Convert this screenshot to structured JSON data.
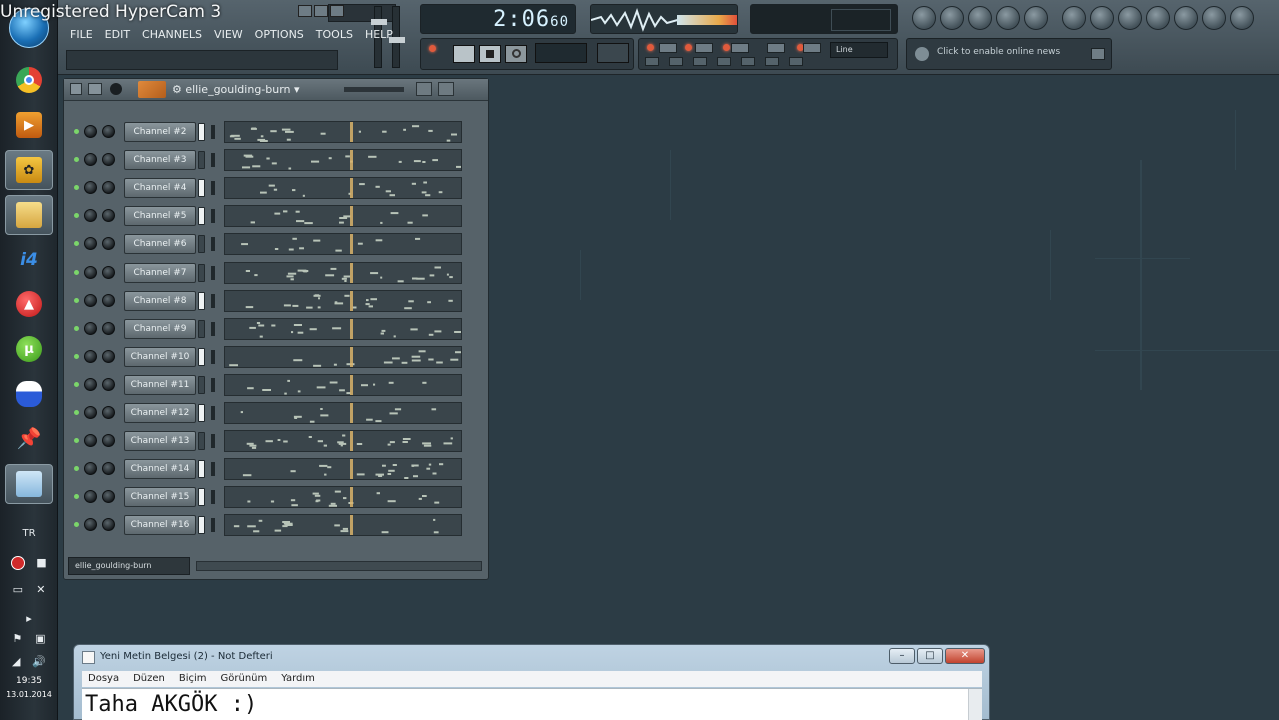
{
  "recorder_watermark": "Unregistered HyperCam 3",
  "menu": [
    "FILE",
    "EDIT",
    "CHANNELS",
    "VIEW",
    "OPTIONS",
    "TOOLS",
    "HELP"
  ],
  "transport": {
    "song_time": "2:06",
    "song_time_sub": "60"
  },
  "snap": {
    "value": "Line"
  },
  "news": {
    "text": "Click to enable online news"
  },
  "sequencer": {
    "pattern_name": "ellie_goulding-burn",
    "footer_pattern": "ellie_goulding-burn",
    "channels": [
      {
        "label": "Channel #2",
        "selected": true
      },
      {
        "label": "Channel #3",
        "selected": false
      },
      {
        "label": "Channel #4",
        "selected": true
      },
      {
        "label": "Channel #5",
        "selected": true
      },
      {
        "label": "Channel #6",
        "selected": false
      },
      {
        "label": "Channel #7",
        "selected": false
      },
      {
        "label": "Channel #8",
        "selected": true
      },
      {
        "label": "Channel #9",
        "selected": false
      },
      {
        "label": "Channel #10",
        "selected": true
      },
      {
        "label": "Channel #11",
        "selected": false
      },
      {
        "label": "Channel #12",
        "selected": true
      },
      {
        "label": "Channel #13",
        "selected": false
      },
      {
        "label": "Channel #14",
        "selected": true
      },
      {
        "label": "Channel #15",
        "selected": true
      },
      {
        "label": "Channel #16",
        "selected": true
      }
    ]
  },
  "taskbar": {
    "icons": [
      "hypercam-icon",
      "chrome-icon",
      "media-player-icon",
      "fl-studio-icon",
      "explorer-icon",
      "i4-icon",
      "red-app-icon",
      "utorrent-icon",
      "messenger-icon",
      "pin-icon",
      "notepad-icon"
    ],
    "language": "TR",
    "time": "19:35",
    "date": "13.01.2014"
  },
  "notepad": {
    "title": "Yeni Metin Belgesi (2) - Not Defteri",
    "menu": [
      "Dosya",
      "Düzen",
      "Biçim",
      "Görünüm",
      "Yardım"
    ],
    "content": "Taha AKGÖK :)"
  },
  "colors": {
    "background": "#2c3c45",
    "playhead": "#d9b36a",
    "led_green": "#7bd66a",
    "led_red": "#e05a3c"
  }
}
